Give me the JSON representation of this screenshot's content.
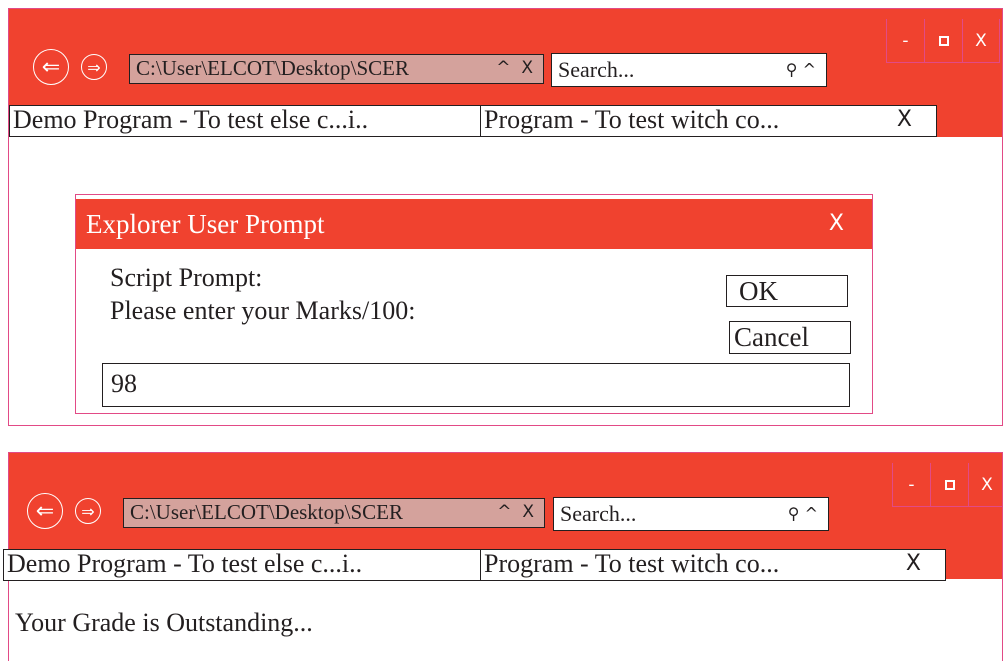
{
  "window": {
    "controls": {
      "minimize": "-",
      "close": "X"
    },
    "address": {
      "path": "C:\\User\\ELCOT\\Desktop\\SCER",
      "chevron": "^",
      "close": "X"
    },
    "search": {
      "placeholder": "Search...",
      "chevron": "^"
    },
    "tabs": [
      {
        "label": "Demo Program - To test else c...i.."
      },
      {
        "label": "Program - To test witch co...",
        "close": "X"
      }
    ]
  },
  "dialog": {
    "title": "Explorer User Prompt",
    "close": "X",
    "prompt_label": "Script Prompt:",
    "prompt_text": "Please enter your Marks/100:",
    "ok_label": "OK",
    "cancel_label": "Cancel",
    "input_value": "98"
  },
  "result": {
    "message": "Your Grade is Outstanding..."
  },
  "colors": {
    "titlebar": "#f0422f",
    "border_accent": "#e24a86",
    "address_bg": "#d4a29c"
  },
  "icons": [
    "back-arrow-icon",
    "forward-arrow-icon",
    "search-icon",
    "minimize-icon",
    "maximize-icon",
    "close-icon"
  ]
}
